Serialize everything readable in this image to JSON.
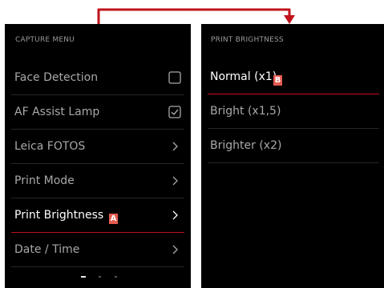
{
  "colors": {
    "accent": "#c0121a",
    "badge": "#e45b4f",
    "panel": "#000000"
  },
  "left_panel": {
    "header": "CAPTURE MENU",
    "items": [
      {
        "label": "Face Detection",
        "control": "checkbox",
        "checked": false
      },
      {
        "label": "AF Assist Lamp",
        "control": "checkbox",
        "checked": true
      },
      {
        "label": "Leica FOTOS",
        "control": "chevron"
      },
      {
        "label": "Print Mode",
        "control": "chevron"
      },
      {
        "label": "Print Brightness",
        "control": "chevron",
        "selected": true,
        "badge": "A"
      },
      {
        "label": "Date / Time",
        "control": "chevron"
      }
    ],
    "page_indicator": {
      "pages": 3,
      "current": 1
    }
  },
  "right_panel": {
    "header": "PRINT BRIGHTNESS",
    "items": [
      {
        "label": "Normal (x1)",
        "selected": true,
        "badge": "B"
      },
      {
        "label": "Bright (x1,5)"
      },
      {
        "label": "Brighter (x2)"
      }
    ]
  }
}
